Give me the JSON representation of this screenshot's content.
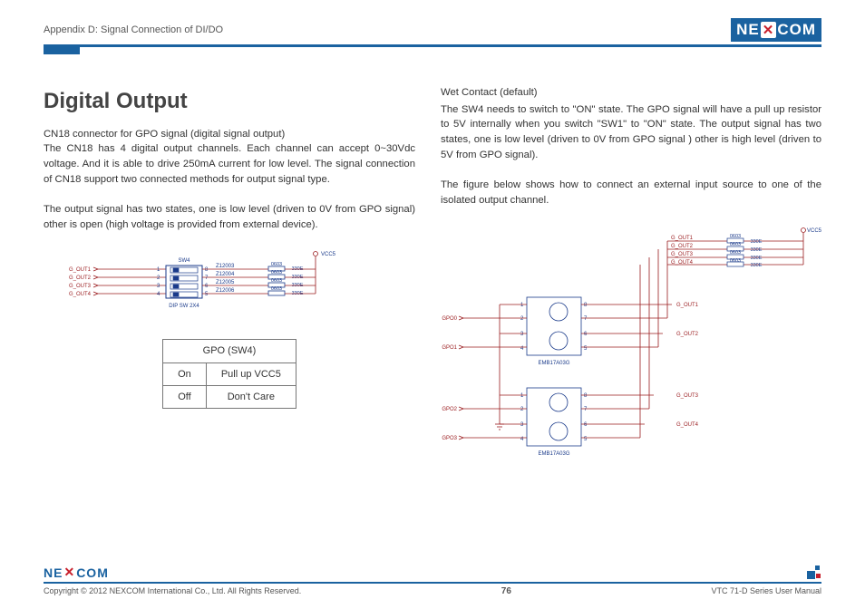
{
  "header": {
    "appendix": "Appendix D: Signal Connection of DI/DO",
    "logo": "NEXCOM"
  },
  "title": "Digital Output",
  "left": {
    "p1": "CN18 connector for GPO signal (digital signal output)",
    "p2": "The CN18 has 4 digital output channels. Each channel can accept 0~30Vdc voltage. And it is able to drive 250mA current for low level. The signal connection of CN18 support two connected methods for output signal type.",
    "p3": "The output signal has two states, one is low level (driven to 0V from GPO signal) other is open (high voltage is provided from external device).",
    "table": {
      "title": "GPO (SW4)",
      "rows": [
        {
          "a": "On",
          "b": "Pull up VCC5"
        },
        {
          "a": "Off",
          "b": "Don't Care"
        }
      ]
    },
    "dia1": {
      "vcc": "VCC5",
      "sw4": "SW4",
      "dip": "DIP SW 2X4",
      "gout": [
        "G_OUT1",
        "G_OUT2",
        "G_OUT3",
        "G_OUT4"
      ],
      "pins_l": [
        "1",
        "2",
        "3",
        "4"
      ],
      "pins_r": [
        "8",
        "7",
        "6",
        "5"
      ],
      "z": [
        "Z12003",
        "Z12004",
        "Z12005",
        "Z12006"
      ],
      "cap": "0603",
      "res": "330E"
    }
  },
  "right": {
    "sub": "Wet Contact (default)",
    "p1": "The SW4 needs to switch to \"ON\" state. The GPO signal will have a pull up resistor to 5V internally when you switch \"SW1\" to \"ON\" state. The output signal has two states, one is low level (driven to 0V from GPO signal ) other is high level (driven to 5V from GPO signal).",
    "p2": "The figure below shows how to connect an external input source to one of the isolated output channel.",
    "dia2": {
      "vcc": "VCC5",
      "emb": "EMB17A03G",
      "gpo": [
        "GPO0",
        "GPO1",
        "GPO2",
        "GPO3"
      ],
      "gout": [
        "G_OUT1",
        "G_OUT2",
        "G_OUT3",
        "G_OUT4"
      ],
      "cap": "0603",
      "res": "330E",
      "p18": [
        "1",
        "2",
        "3",
        "4",
        "8",
        "7",
        "6",
        "5"
      ]
    }
  },
  "footer": {
    "copy": "Copyright © 2012 NEXCOM International Co., Ltd. All Rights Reserved.",
    "page": "76",
    "manual": "VTC 71-D Series User Manual"
  }
}
